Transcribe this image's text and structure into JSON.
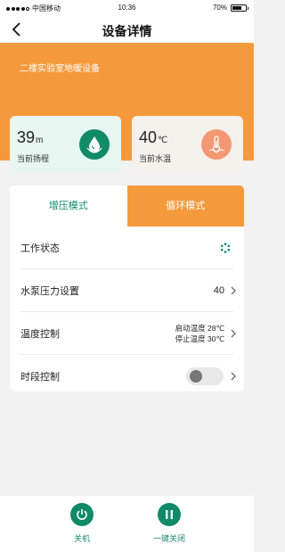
{
  "status_bar": {
    "carrier": "中国移动",
    "time": "10:36",
    "battery": "70%",
    "battery_level": 0.7
  },
  "nav": {
    "title": "设备详情",
    "back_icon": "chevron-left-icon"
  },
  "device": {
    "name": "二楼实验室地暖设备"
  },
  "stats": {
    "lift": {
      "value": "39",
      "unit": "m",
      "label": "当前扬程",
      "icon": "water-drop-icon"
    },
    "water_temp": {
      "value": "40",
      "unit": "℃",
      "label": "当前水温",
      "icon": "thermometer-icon"
    }
  },
  "tabs": [
    {
      "label": "增压模式",
      "active": false
    },
    {
      "label": "循环模式",
      "active": true
    }
  ],
  "rows": {
    "work_status": {
      "label": "工作状态",
      "icon": "spinner-icon"
    },
    "pump_pressure": {
      "label": "水泵压力设置",
      "value": "40"
    },
    "temperature": {
      "label": "温度控制",
      "start": "启动温度 28℃",
      "stop": "停止温度 30℃"
    },
    "time_slot": {
      "label": "时段控制",
      "toggle_on": false
    }
  },
  "footer": {
    "power_label": "关机",
    "close_label": "一键关闭"
  },
  "colors": {
    "accent_orange": "#f59a3c",
    "accent_green": "#118a68"
  }
}
